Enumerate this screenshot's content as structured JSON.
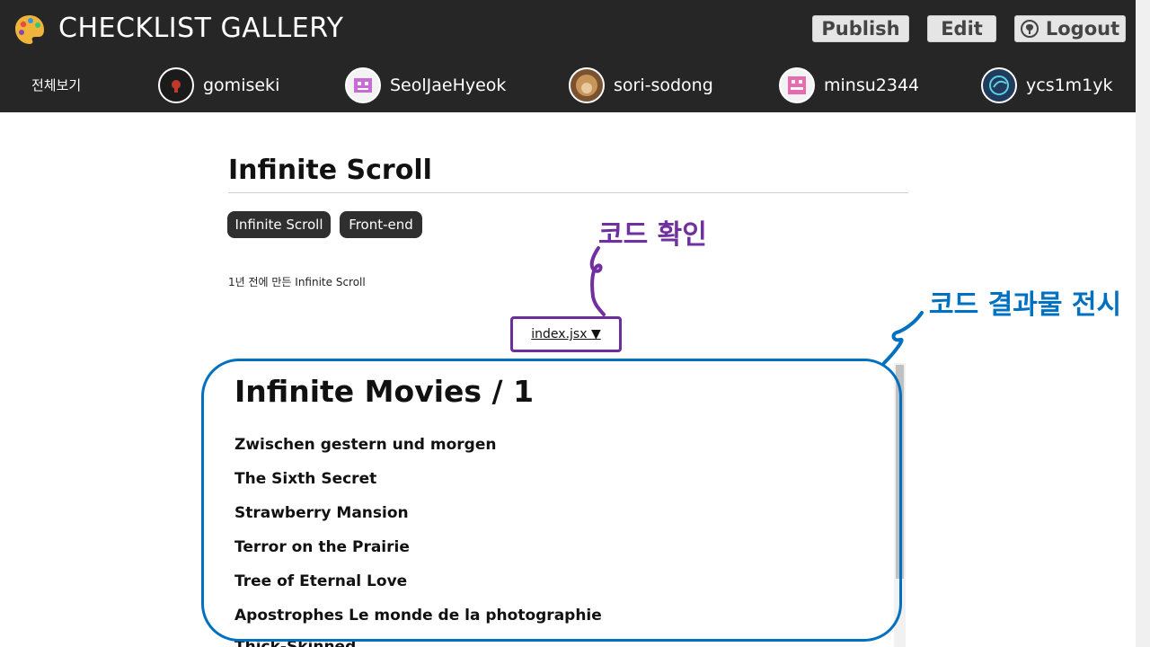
{
  "app": {
    "title": "CHECKLIST GALLERY"
  },
  "header": {
    "publish_label": "Publish",
    "edit_label": "Edit",
    "logout_label": "Logout"
  },
  "nav": {
    "all_label": "전체보기",
    "users": [
      {
        "name": "gomiseki"
      },
      {
        "name": "SeolJaeHyeok"
      },
      {
        "name": "sori-sodong"
      },
      {
        "name": "minsu2344"
      },
      {
        "name": "ycs1m1yk"
      }
    ]
  },
  "post": {
    "title": "Infinite Scroll",
    "tags": [
      "Infinite Scroll",
      "Front-end"
    ],
    "meta": "1년 전에 만든 Infinite Scroll",
    "file_label": "index.jsx ▼"
  },
  "annotations": {
    "code_check": "코드 확인",
    "code_result": "코드 결과물 전시",
    "purple": "#7030a0",
    "blue": "#0070c0"
  },
  "preview": {
    "heading": "Infinite Movies / 1",
    "movies": [
      "Zwischen gestern und morgen",
      "The Sixth Secret",
      "Strawberry Mansion",
      "Terror on the Prairie",
      "Tree of Eternal Love",
      "Apostrophes Le monde de la photographie",
      "Thick-Skinned"
    ]
  }
}
